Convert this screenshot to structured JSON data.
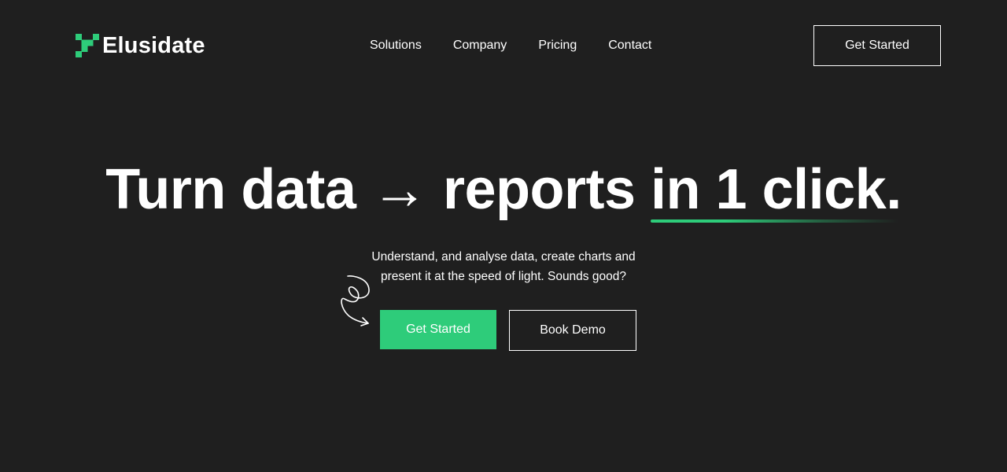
{
  "colors": {
    "background": "#1f1f1f",
    "accent": "#2ecc7a",
    "text": "#ffffff"
  },
  "header": {
    "logo": {
      "icon": "pixel-logo-icon",
      "text": "Elusidate"
    },
    "nav": [
      {
        "label": "Solutions"
      },
      {
        "label": "Company"
      },
      {
        "label": "Pricing"
      },
      {
        "label": "Contact"
      }
    ],
    "cta_label": "Get Started"
  },
  "hero": {
    "title_part1": "Turn data",
    "arrow": "→",
    "title_part2": "reports",
    "title_highlight": "in 1 click.",
    "subtitle_line1": "Understand, and analyse data, create charts and",
    "subtitle_line2": "present it at the speed of light. Sounds good?",
    "doodle_icon": "curly-arrow-icon",
    "primary_cta": "Get Started",
    "secondary_cta": "Book Demo"
  }
}
